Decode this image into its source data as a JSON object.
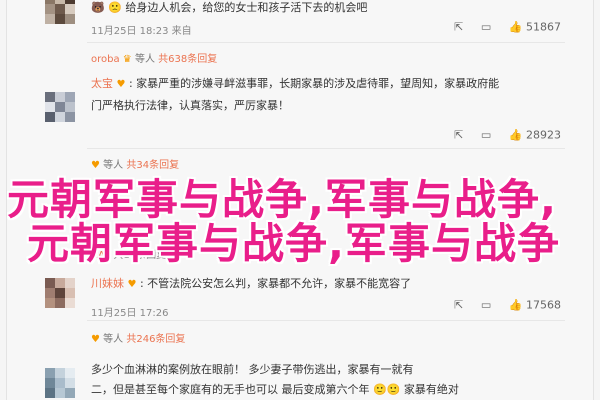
{
  "comments": [
    {
      "line1": "🐻 🙁 给身边人机会，给您的女士和孩子活下去的机会吧",
      "meta": "11月25日 18:23",
      "meta_suffix": "来自",
      "likes": "51867",
      "avatar_colors": [
        "#8a7766",
        "#c8b9a9",
        "#4d3b30",
        "#a39283",
        "#6e5a4c",
        "#d7cbbf",
        "#bfb1a4",
        "#5c4a3d",
        "#9e8f81"
      ]
    },
    {
      "reply_name": "oroba",
      "reply_text": "等人",
      "reply_total": "共638条回复",
      "avatar_colors": []
    },
    {
      "name": "太宝",
      "line1": "家暴严重的涉嫌寻衅滋事罪，长期家暴的涉及虐待罪，望周知，家暴政府能",
      "line2": "门严格执行法律，认真落实，严厉家暴！",
      "meta": "11月25日 17:03",
      "likes": "28923",
      "avatar_colors": [
        "#6a6f7c",
        "#c9cdd6",
        "#9ea6b5",
        "#e1e4ea",
        "#7f8696",
        "#bcc2cc",
        "#59606e",
        "#d0d5dd",
        "#8c94a3"
      ]
    },
    {
      "reply_name": "",
      "reply_text": "等人",
      "reply_total": "共34条回复",
      "avatar_colors": []
    },
    {
      "name": "CAT",
      "reply_total": "共17条回复",
      "avatar_colors": []
    },
    {
      "name": "川妹妹",
      "line1": "不管法院公安怎么判，家暴都不允许，家暴不能宽容了",
      "meta": "11月25日 17:26",
      "likes": "17568",
      "avatar_colors": [
        "#7a5b52",
        "#c7a99b",
        "#e4d3ca",
        "#9f7d70",
        "#5e443b",
        "#d8bfb2",
        "#b3917f",
        "#8c6b5f",
        "#eadcd4"
      ]
    },
    {
      "reply_text": "等人",
      "reply_total": "共246条回复",
      "avatar_colors": []
    },
    {
      "line1": "多少个血淋淋的案例放在眼前！ 多少妻子带伤逃出，家暴有一就有",
      "line2": "二，但是甚至每个家庭有的无手也可以 最后变成第六个年 🙂🙂 家暴有绝对",
      "avatar_colors": [
        "#8aa0b0",
        "#c4d2dc",
        "#e5ecf1",
        "#6f8798",
        "#a9bccb",
        "#d3dee6",
        "#5c7384",
        "#b7c8d4",
        "#93a8b7"
      ]
    }
  ],
  "overlay": {
    "line1": "元朝军事与战争,军事与战争,",
    "line2": "元朝军事与战争,军事与战争"
  },
  "actions": {
    "share_icon": "share-icon",
    "comment_icon": "comment-icon",
    "like_icon": "like-icon"
  },
  "colors": {
    "accent": "#eb7350",
    "overlay": "#e91e8a"
  }
}
